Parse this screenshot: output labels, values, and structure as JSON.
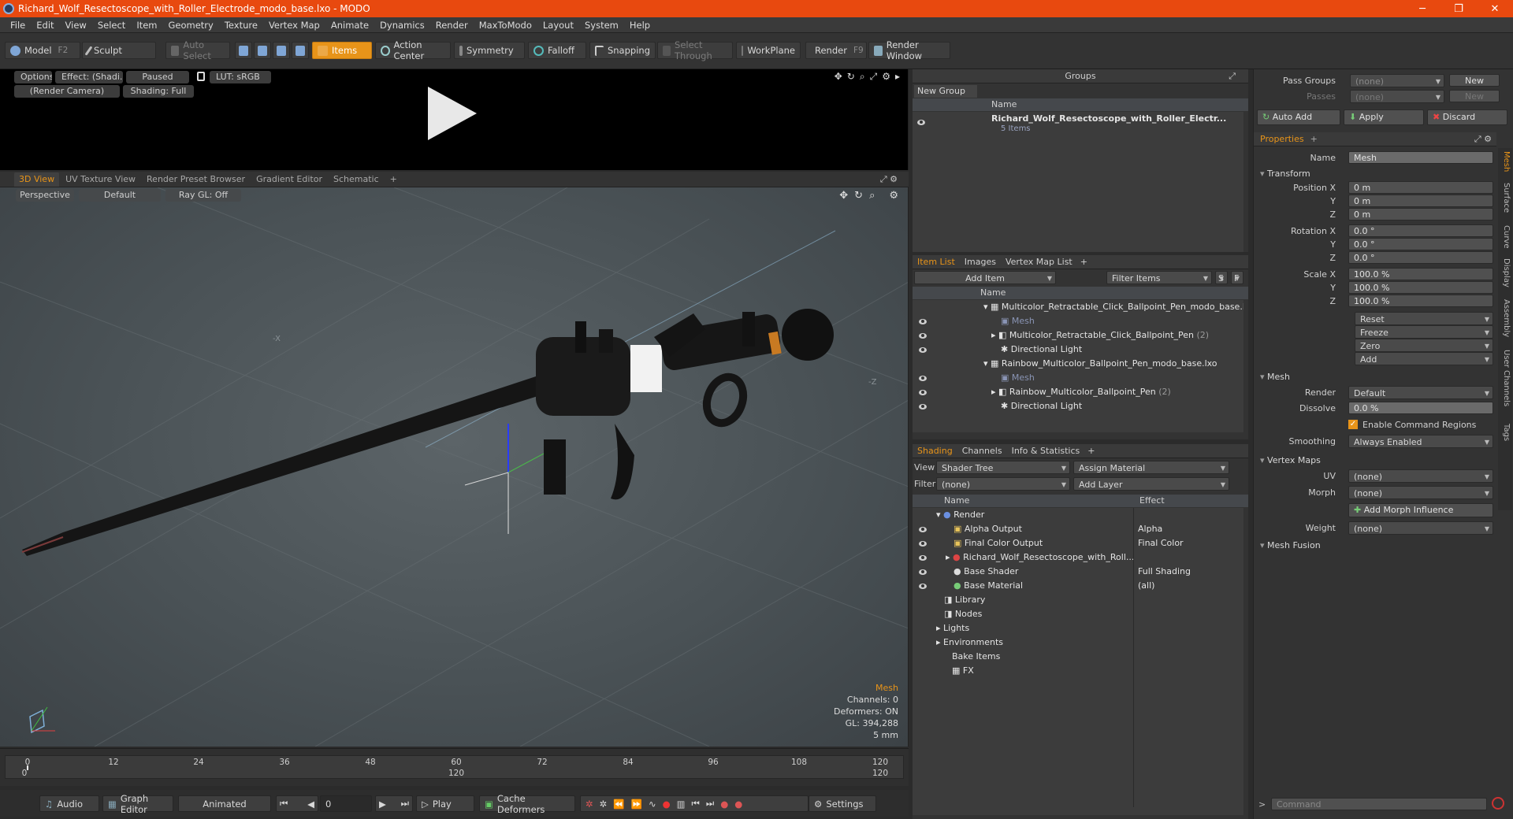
{
  "window": {
    "title": "Richard_Wolf_Resectoscope_with_Roller_Electrode_modo_base.lxo - MODO",
    "controls": [
      "─",
      "❐",
      "✕"
    ]
  },
  "menu": [
    "File",
    "Edit",
    "View",
    "Select",
    "Item",
    "Geometry",
    "Texture",
    "Vertex Map",
    "Animate",
    "Dynamics",
    "Render",
    "MaxToModo",
    "Layout",
    "System",
    "Help"
  ],
  "toolbar": {
    "model": "Model",
    "model_key": "F2",
    "sculpt": "Sculpt",
    "auto_select": "Auto Select",
    "items": "Items",
    "action_center": "Action Center",
    "symmetry": "Symmetry",
    "falloff": "Falloff",
    "snapping": "Snapping",
    "select_through": "Select Through",
    "workplane": "WorkPlane",
    "render": "Render",
    "render_key": "F9",
    "render_window": "Render Window"
  },
  "preview": {
    "options": "Options",
    "effect": "Effect: (Shadi...",
    "paused": "Paused",
    "lut": "LUT: sRGB",
    "camera": "(Render Camera)",
    "shading": "Shading: Full"
  },
  "viewport_tabs": [
    "3D View",
    "UV Texture View",
    "Render Preset Browser",
    "Gradient Editor",
    "Schematic"
  ],
  "viewport": {
    "perspective": "Perspective",
    "style": "Default",
    "raygl": "Ray GL: Off",
    "info": {
      "selection": "Mesh",
      "channels": "Channels: 0",
      "deformers": "Deformers: ON",
      "gl": "GL: 394,288",
      "scale": "5 mm"
    }
  },
  "timeline": {
    "ticks": [
      "0",
      "12",
      "24",
      "36",
      "48",
      "60",
      "72",
      "84",
      "96",
      "108",
      "120"
    ],
    "sub": [
      "0",
      "120",
      "120"
    ]
  },
  "bottom": {
    "audio": "Audio",
    "graph_editor": "Graph Editor",
    "animated": "Animated",
    "frame": "0",
    "play": "Play",
    "cache": "Cache Deformers",
    "settings": "Settings"
  },
  "groups": {
    "title": "Groups",
    "new_group": "New Group",
    "col_name": "Name",
    "item_name": "Richard_Wolf_Resectoscope_with_Roller_Electr...",
    "item_count": "5 Items"
  },
  "itemlist": {
    "tabs": [
      "Item List",
      "Images",
      "Vertex Map List"
    ],
    "add_item": "Add Item",
    "filter": "Filter Items",
    "s": "S",
    "f": "F",
    "col_name": "Name",
    "rows": [
      {
        "label": "Multicolor_Retractable_Click_Ballpoint_Pen_modo_base.lxo",
        "indent": 0,
        "kind": "scene"
      },
      {
        "label": "Mesh",
        "indent": 1,
        "kind": "mesh"
      },
      {
        "label": "Multicolor_Retractable_Click_Ballpoint_Pen",
        "count": "(2)",
        "indent": 1,
        "kind": "group"
      },
      {
        "label": "Directional Light",
        "indent": 1,
        "kind": "light"
      },
      {
        "label": "Rainbow_Multicolor_Ballpoint_Pen_modo_base.lxo",
        "indent": 0,
        "kind": "scene"
      },
      {
        "label": "Mesh",
        "indent": 1,
        "kind": "mesh"
      },
      {
        "label": "Rainbow_Multicolor_Ballpoint_Pen",
        "count": "(2)",
        "indent": 1,
        "kind": "group"
      },
      {
        "label": "Directional Light",
        "indent": 1,
        "kind": "light"
      }
    ]
  },
  "shading": {
    "tabs": [
      "Shading",
      "Channels",
      "Info & Statistics"
    ],
    "view_label": "View",
    "view": "Shader Tree",
    "assign": "Assign Material",
    "filter_label": "Filter",
    "filter": "(none)",
    "add_layer": "Add Layer",
    "col_name": "Name",
    "col_effect": "Effect",
    "rows": [
      {
        "label": "Render",
        "effect": "",
        "indent": 0
      },
      {
        "label": "Alpha Output",
        "effect": "Alpha",
        "indent": 1
      },
      {
        "label": "Final Color Output",
        "effect": "Final Color",
        "indent": 1
      },
      {
        "label": "Richard_Wolf_Resectoscope_with_Roll...",
        "effect": "",
        "indent": 1
      },
      {
        "label": "Base Shader",
        "effect": "Full Shading",
        "indent": 1
      },
      {
        "label": "Base Material",
        "effect": "(all)",
        "indent": 1
      },
      {
        "label": "Library",
        "effect": "",
        "indent": 0
      },
      {
        "label": "Nodes",
        "effect": "",
        "indent": 0
      },
      {
        "label": "Lights",
        "effect": "",
        "indent": -1
      },
      {
        "label": "Environments",
        "effect": "",
        "indent": -1
      },
      {
        "label": "Bake Items",
        "effect": "",
        "indent": -1
      },
      {
        "label": "FX",
        "effect": "",
        "indent": 0
      }
    ]
  },
  "properties": {
    "pass_groups": "Pass Groups",
    "passes": "Passes",
    "none": "(none)",
    "new": "New",
    "auto_add": "Auto Add",
    "apply": "Apply",
    "discard": "Discard",
    "tab": "Properties",
    "name_label": "Name",
    "name": "Mesh",
    "transform": "Transform",
    "position_x": "Position X",
    "rotation_x": "Rotation X",
    "scale_x": "Scale X",
    "y": "Y",
    "z": "Z",
    "pos": [
      "0 m",
      "0 m",
      "0 m"
    ],
    "rot": [
      "0.0 °",
      "0.0 °",
      "0.0 °"
    ],
    "scl": [
      "100.0 %",
      "100.0 %",
      "100.0 %"
    ],
    "actions": [
      "Reset",
      "Freeze",
      "Zero",
      "Add"
    ],
    "mesh": "Mesh",
    "render_label": "Render",
    "render": "Default",
    "dissolve_label": "Dissolve",
    "dissolve": "0.0 %",
    "cmd_regions": "Enable Command Regions",
    "smoothing_label": "Smoothing",
    "smoothing": "Always Enabled",
    "vertex_maps": "Vertex Maps",
    "uv_label": "UV",
    "uv": "(none)",
    "morph_label": "Morph",
    "morph": "(none)",
    "add_morph": "Add Morph Influence",
    "weight_label": "Weight",
    "weight": "(none)",
    "mesh_fusion": "Mesh Fusion",
    "side_tabs": [
      "Mesh",
      "Surface",
      "Curve",
      "Display",
      "Assembly",
      "User Channels",
      "Tags"
    ],
    "command": "Command"
  }
}
